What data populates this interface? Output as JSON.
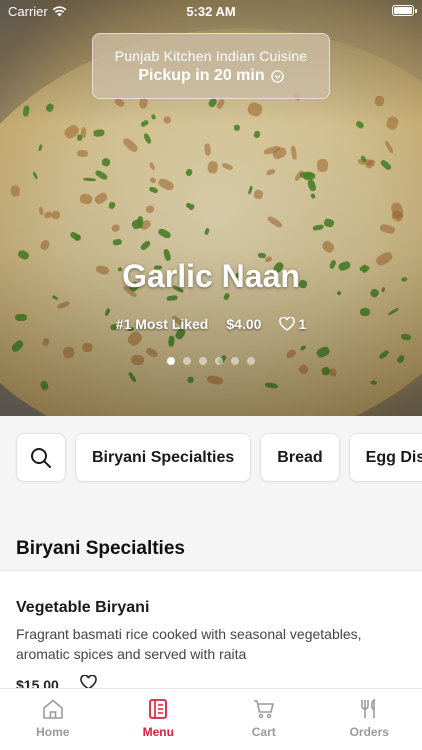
{
  "status_bar": {
    "carrier": "Carrier",
    "time": "5:32 AM"
  },
  "restaurant": {
    "name": "Punjab Kitchen Indian Cuisine",
    "pickup": "Pickup in 20 min"
  },
  "featured": {
    "title": "Garlic Naan",
    "badge": "#1 Most Liked",
    "price": "$4.00",
    "likes": "1",
    "carousel": {
      "count": 6,
      "active_index": 0
    }
  },
  "categories": {
    "search_icon": "search-icon",
    "items": [
      {
        "label": "Biryani Specialties"
      },
      {
        "label": "Bread"
      },
      {
        "label": "Egg Dishes"
      }
    ]
  },
  "section": {
    "title": "Biryani Specialties"
  },
  "menu_items": [
    {
      "name": "Vegetable Biryani",
      "description": "Fragrant basmati rice cooked with seasonal vegetables, aromatic spices and served with raita",
      "price": "$15.00"
    }
  ],
  "tabbar": {
    "tabs": [
      {
        "label": "Home",
        "icon": "home-icon",
        "active": false
      },
      {
        "label": "Menu",
        "icon": "menu-icon",
        "active": true
      },
      {
        "label": "Cart",
        "icon": "cart-icon",
        "active": false
      },
      {
        "label": "Orders",
        "icon": "fork-knife-icon",
        "active": false
      }
    ]
  },
  "colors": {
    "accent": "#d6203a",
    "inactive_tab": "#9a9a9a",
    "band": "#f5f5f5"
  }
}
